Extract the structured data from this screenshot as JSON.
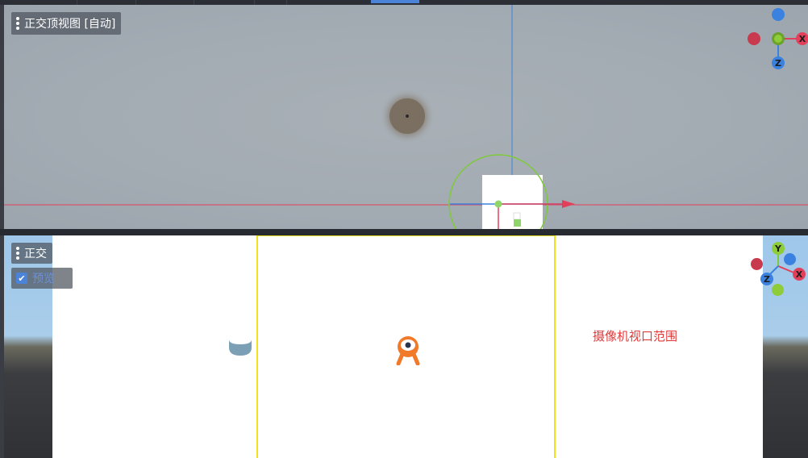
{
  "top_viewport": {
    "label": "正交顶视图 [自动]",
    "gizmo": {
      "x_label": "X",
      "z_label": "Z"
    }
  },
  "bottom_viewport": {
    "label": "正交",
    "checkbox": {
      "checked": true,
      "label": "预览"
    },
    "gizmo": {
      "x_label": "X",
      "y_label": "Y",
      "z_label": "Z"
    },
    "camera_note": "摄像机视口范围"
  },
  "colors": {
    "x_axis": "#e2405a",
    "y_axis": "#7fc93a",
    "z_axis": "#3b82e0",
    "frame": "#f2e21d",
    "accent": "#4a83d8"
  }
}
